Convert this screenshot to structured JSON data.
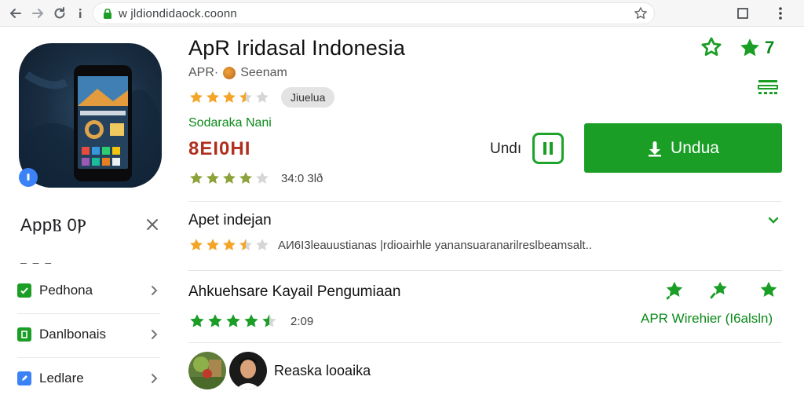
{
  "browser": {
    "url": "w jldiondidaock.coonn",
    "icons": [
      "back-arrow-icon",
      "forward-arrow-icon",
      "reload-icon",
      "info-icon",
      "lock-icon",
      "bookmark-star-icon",
      "window-restore-icon",
      "more-vert-icon"
    ]
  },
  "app": {
    "title": "ApR Iridasal Indonesia",
    "developer_prefix": "APR·",
    "developer_name": "Seenam",
    "rating_pill": "Jiuelua",
    "green_label": "Sodaraka Nani",
    "price_text": "8EI0ΗI",
    "rating_count": "34:0 3lð",
    "top_number": "7",
    "undu_label": "Undı",
    "install_label": "Undua"
  },
  "sidebar": {
    "title": "AppⲂ 0Ⲣ",
    "dash": "– – –",
    "items": [
      {
        "label": "Pedhona",
        "icon": "check-square-icon"
      },
      {
        "label": "Danlbonais",
        "icon": "page-square-icon"
      },
      {
        "label": "Ledlare",
        "icon": "edit-square-icon"
      }
    ]
  },
  "sections": [
    {
      "title": "Apet indejan",
      "rating": 3.5,
      "description": "AИ6I3leauustianas |rdioairhle yanansuaranarilreslbeamsalt.."
    },
    {
      "title": "Ahkuehsare Kayail Pengumiaan",
      "rating": 4.5,
      "count": "2:09",
      "link": "APR Wirehier (I6alsln)"
    }
  ],
  "reviewer": {
    "name": "Reaska looaika"
  },
  "ratings": {
    "header": 3.5,
    "secondary": 4
  },
  "colors": {
    "green": "#1a9e25",
    "star_gold": "#f3a52a",
    "star_olive": "#8ca23a",
    "price_red": "#b0301f"
  }
}
